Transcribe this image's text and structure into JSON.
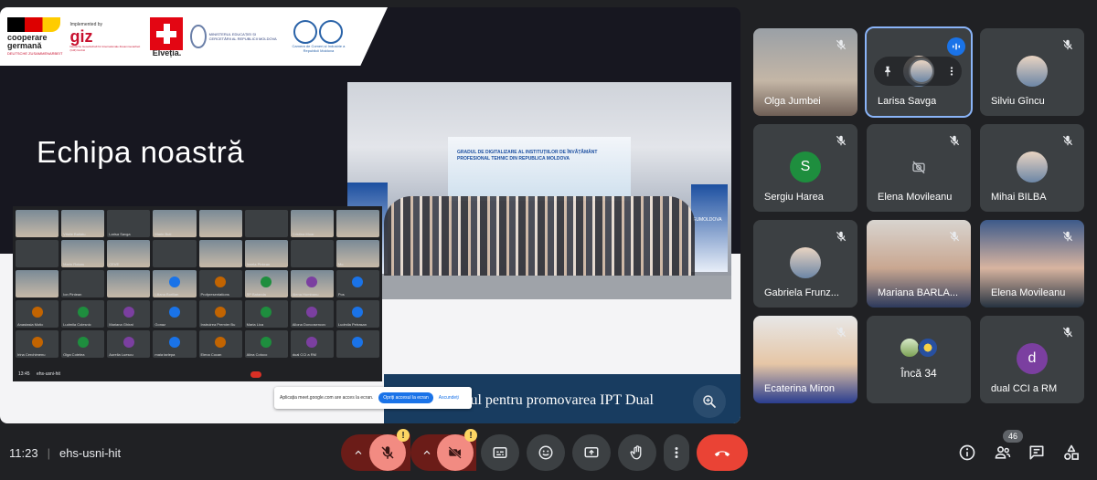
{
  "slide": {
    "title": "Echipa noastră",
    "logos": {
      "coop_line1": "cooperare",
      "coop_line2": "germană",
      "coop_line3": "DEUTSCHE ZUSAMMENARBEIT",
      "implemented": "Implemented by",
      "giz": "giz",
      "giz_sub": "Deutsche Gesellschaft für Internationale Zusammenarbeit (GIZ) GmbH",
      "swiss": "Elveția.",
      "ministry": "MINISTERUL EDUCAȚIEI ȘI CERCETĂRII AL REPUBLICII MOLDOVA",
      "chamber": "Camera de Comerț și Industrie a Republicii Moldova"
    },
    "photo_banner": "GRADUL DE DIGITALIZARE AL INSTITUȚIILOR DE ÎNVĂȚĂMÂNT PROFESIONAL TEHNIC DIN REPUBLICA MOLDOVA",
    "photo_rollup": "EUMOLDOVA",
    "footer_text": "tul pentru promovarea IPT Dual",
    "share_notice": {
      "message": "Aplicația meet.google.com are acces la ecran.",
      "stop_label": "Opriți accesul la ecran",
      "hide_label": "Ascundeți"
    },
    "mini_grid": {
      "names": [
        "",
        "Vitalie Baltatu",
        "Larisa Savga",
        "Marin Buti",
        "",
        "",
        "Cristina Moar",
        "",
        "",
        "Marin Rotaru",
        "CEVE",
        "",
        "",
        "Ionela Pintean",
        "",
        "Mo",
        "",
        "Ion Pintean",
        "",
        "Liliana Borilian",
        "Profpresentations",
        "SP Batanda",
        "Alena Hombanu",
        "Pos",
        "Anastasia Motic",
        "Ludmila Colesnic",
        "Mariana Ghirat",
        "Gonaz",
        "Instruirea Premier Bu",
        "Maria Lica",
        "Allona Doncosencov",
        "Ludmila Petrasan",
        "Irina Cerchimenu",
        "Olga Cotelea",
        "Aurelia Luescu",
        "maia tarlepa",
        "Elena Cocan",
        "Alina Cotoco",
        "dual CCI a RM",
        ""
      ],
      "clock": "13:45",
      "code": "ehs-usni-hit"
    }
  },
  "participants": [
    {
      "name": "Olga Jumbei",
      "type": "video",
      "muted": true
    },
    {
      "name": "Larisa Savga",
      "type": "photo",
      "muted": false,
      "speaking": true,
      "active": true
    },
    {
      "name": "Silviu Gîncu",
      "type": "photo",
      "muted": true
    },
    {
      "name": "Sergiu Harea",
      "type": "letter",
      "letter": "S",
      "color": "#1e8e3e",
      "muted": true
    },
    {
      "name": "Elena Movileanu",
      "type": "camoff",
      "muted": true
    },
    {
      "name": "Mihai BILBA",
      "type": "photo",
      "muted": true
    },
    {
      "name": "Gabriela Frunz...",
      "type": "photo",
      "muted": true
    },
    {
      "name": "Mariana BARLA...",
      "type": "video",
      "muted": true
    },
    {
      "name": "Elena Movileanu",
      "type": "video",
      "muted": true
    },
    {
      "name": "Ecaterina Miron",
      "type": "video",
      "muted": true
    },
    {
      "name": "Încă 34",
      "type": "more"
    },
    {
      "name": "dual CCI a RM",
      "type": "letter",
      "letter": "d",
      "color": "#7b3fa0",
      "muted": true
    }
  ],
  "meeting": {
    "clock": "11:23",
    "code": "ehs-usni-hit",
    "participant_count": "46"
  },
  "colors": {
    "end_call": "#ea4335",
    "accent": "#8ab4f8",
    "control_bg": "#3c4043"
  }
}
